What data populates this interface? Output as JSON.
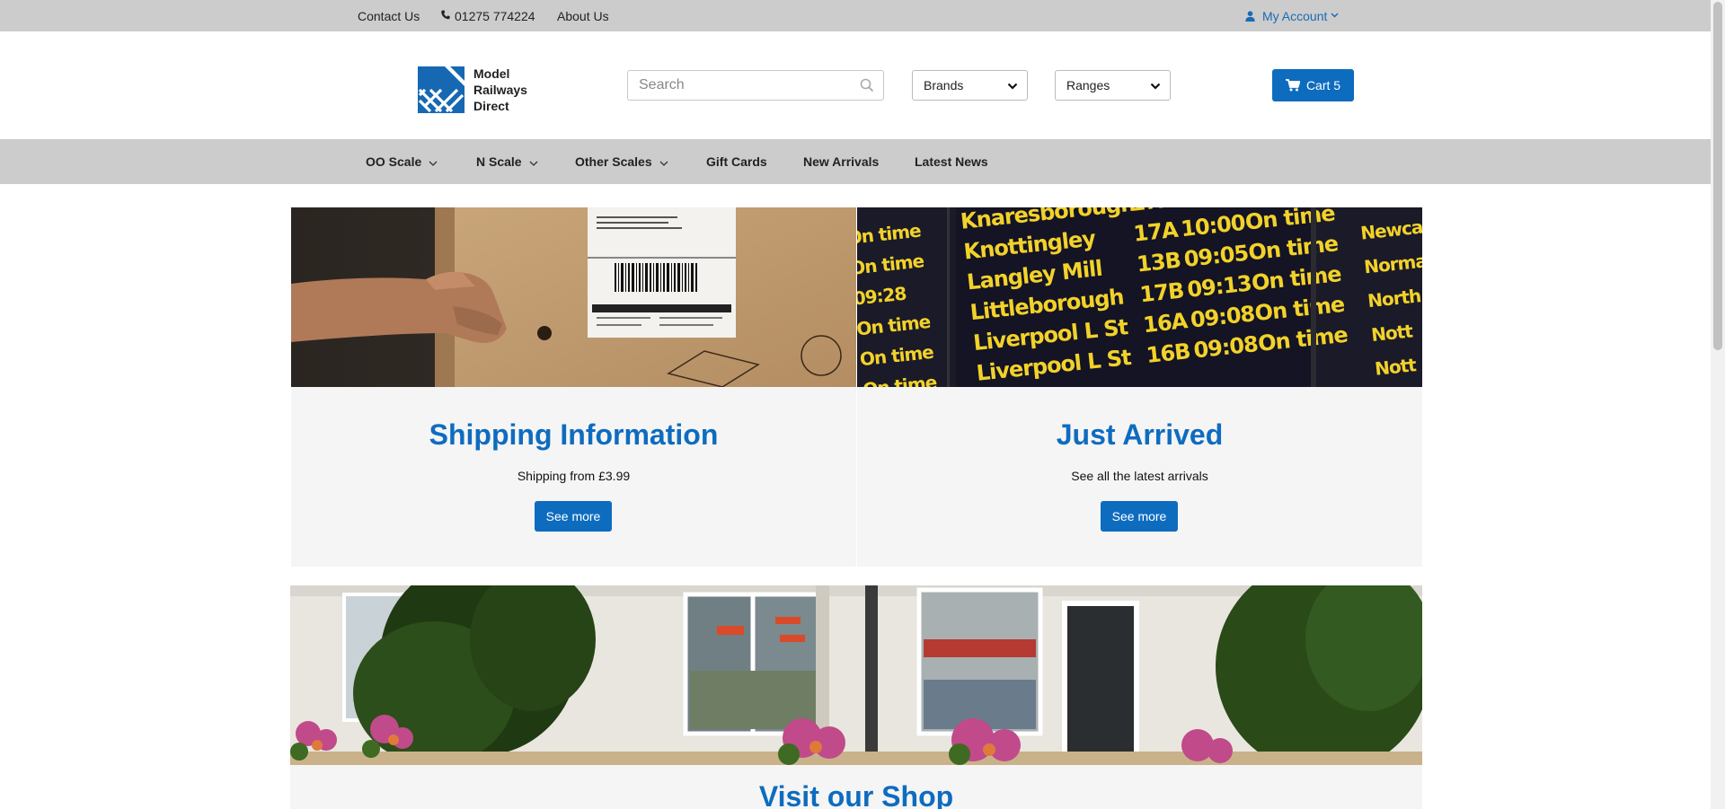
{
  "topbar": {
    "contact_label": "Contact Us",
    "phone_label": "01275 774224",
    "about_label": "About Us",
    "account_label": "My Account"
  },
  "header": {
    "logo_line1": "Model",
    "logo_line2": "Railways",
    "logo_line3": "Direct",
    "search_placeholder": "Search",
    "brands_label": "Brands",
    "ranges_label": "Ranges",
    "cart_label": "Cart 5"
  },
  "nav": {
    "items": [
      {
        "label": "OO Scale",
        "has_dropdown": true
      },
      {
        "label": "N Scale",
        "has_dropdown": true
      },
      {
        "label": "Other Scales",
        "has_dropdown": true
      },
      {
        "label": "Gift Cards",
        "has_dropdown": false
      },
      {
        "label": "New Arrivals",
        "has_dropdown": false
      },
      {
        "label": "Latest News",
        "has_dropdown": false
      }
    ]
  },
  "cards": [
    {
      "title": "Shipping Information",
      "text": "Shipping from £3.99",
      "button": "See more"
    },
    {
      "title": "Just Arrived",
      "text": "See all the latest arrivals",
      "button": "See more"
    }
  ],
  "board": {
    "rows": [
      {
        "dest": "Knaresborough",
        "plat": "17A",
        "time": "10:00",
        "status": "On time"
      },
      {
        "dest": "Knottingley",
        "plat": "17A",
        "time": "10:00",
        "status": "On time"
      },
      {
        "dest": "Langley Mill",
        "plat": "13B",
        "time": "09:05",
        "status": "On time"
      },
      {
        "dest": "Littleborough",
        "plat": "17B",
        "time": "09:13",
        "status": "On time"
      },
      {
        "dest": "Liverpool L St",
        "plat": "16A",
        "time": "09:08",
        "status": "On time"
      },
      {
        "dest": "Liverpool L St",
        "plat": "16B",
        "time": "09:08",
        "status": "On time"
      }
    ],
    "left_col": [
      "On time",
      "On time",
      "09:28",
      "On time",
      "On time",
      "On time"
    ],
    "right_col": [
      "Newcas",
      "Norma",
      "North",
      "Nott",
      "Nott"
    ]
  },
  "shop": {
    "title": "Visit our Shop"
  },
  "colors": {
    "brand_blue": "#0e6cbf",
    "bar_grey": "#cccccc",
    "card_bg": "#f5f5f5"
  },
  "icons": {
    "phone": "phone-icon",
    "account": "user-icon",
    "search": "search-icon",
    "cart": "cart-icon"
  }
}
